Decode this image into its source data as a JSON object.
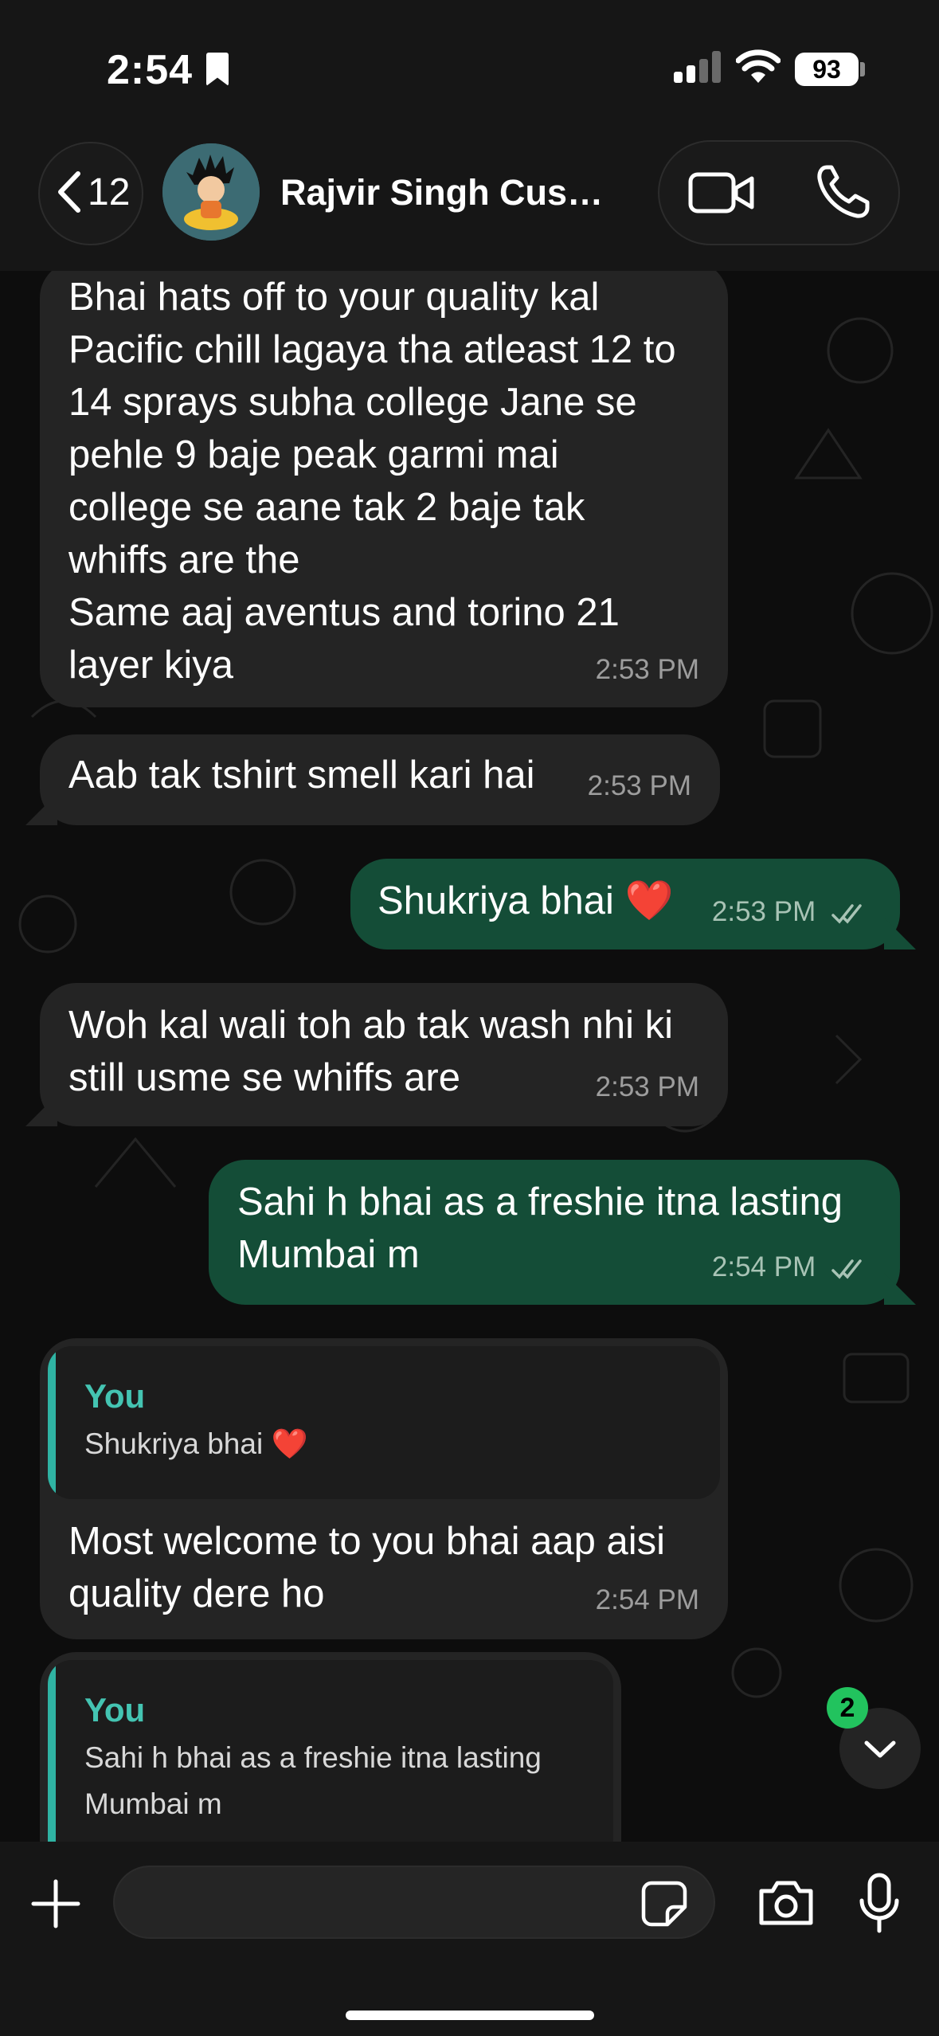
{
  "status_bar": {
    "time": "2:54",
    "battery": "93"
  },
  "header": {
    "back_count": "12",
    "contact_name": "Rajvir Singh Custo...",
    "icons": [
      "chevron-left-icon",
      "video-call-icon",
      "phone-call-icon"
    ]
  },
  "messages": [
    {
      "direction": "incoming",
      "lines": [
        "Bhai hats off to your quality kal",
        "Pacific chill lagaya tha atleast 12 to",
        "14 sprays subha college Jane se",
        "pehle 9 baje peak garmi mai",
        "college se aane tak 2 baje tak",
        "whiffs are the",
        "Same aaj aventus and torino 21",
        "layer kiya"
      ],
      "time": "2:53 PM"
    },
    {
      "direction": "incoming",
      "lines": [
        "Aab tak tshirt smell kari hai"
      ],
      "time": "2:53 PM"
    },
    {
      "direction": "outgoing",
      "lines": [
        "Shukriya bhai ❤️"
      ],
      "time": "2:53 PM",
      "status": "read"
    },
    {
      "direction": "incoming",
      "lines": [
        "Woh kal wali toh ab tak wash nhi ki",
        "still usme se whiffs are"
      ],
      "time": "2:53 PM"
    },
    {
      "direction": "outgoing",
      "lines": [
        "Sahi h bhai as a freshie itna lasting",
        "Mumbai m"
      ],
      "time": "2:54 PM",
      "status": "read"
    },
    {
      "direction": "incoming",
      "reply_to": {
        "author": "You",
        "text": "Shukriya bhai ❤️"
      },
      "lines": [
        "Most welcome to you bhai aap aisi",
        "quality dere ho"
      ],
      "time": "2:54 PM"
    },
    {
      "direction": "incoming",
      "reply_to": {
        "author": "You",
        "lines": [
          "Sahi h bhai as a freshie itna lasting",
          "Mumbai m"
        ]
      }
    }
  ],
  "scroll_down": {
    "unread_count": "2"
  },
  "composer": {
    "value": "",
    "placeholder": ""
  },
  "colors": {
    "incoming": "#242424",
    "outgoing": "#144d37",
    "accent": "#2fb3a3",
    "badge": "#22c35e"
  }
}
